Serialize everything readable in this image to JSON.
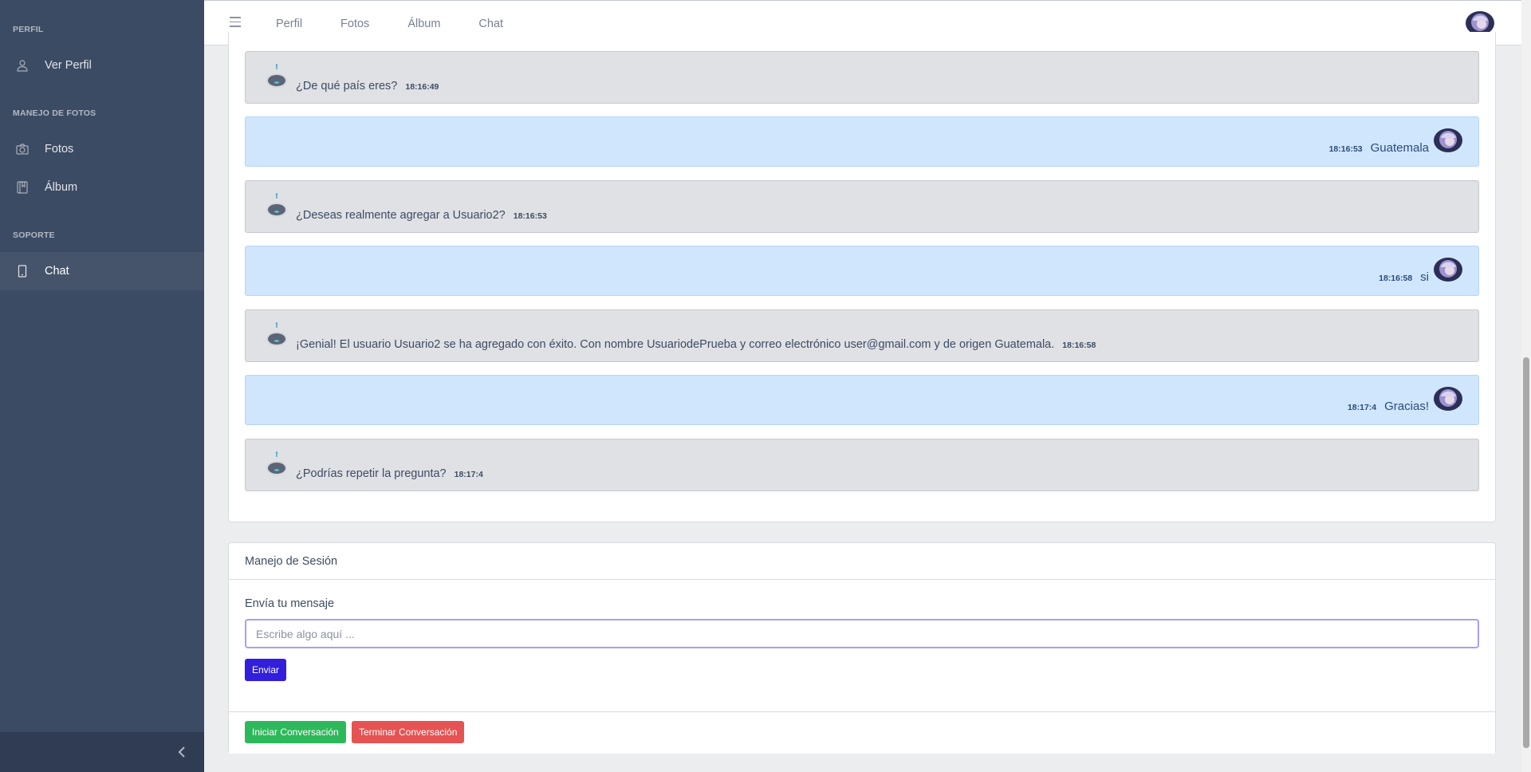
{
  "sidebar": {
    "sections": [
      {
        "title": "PERFIL",
        "items": [
          {
            "label": "Ver Perfil",
            "icon": "user-icon"
          }
        ]
      },
      {
        "title": "MANEJO DE FOTOS",
        "items": [
          {
            "label": "Fotos",
            "icon": "camera-icon"
          },
          {
            "label": "Álbum",
            "icon": "book-icon"
          }
        ]
      },
      {
        "title": "SOPORTE",
        "items": [
          {
            "label": "Chat",
            "icon": "phone-icon",
            "active": true
          }
        ]
      }
    ],
    "toggle_icon": "chevron-left-icon"
  },
  "header": {
    "menu_icon": "hamburger-icon",
    "nav": [
      "Perfil",
      "Fotos",
      "Álbum",
      "Chat"
    ],
    "avatar_icon": "user-avatar"
  },
  "chat": {
    "messages": [
      {
        "sender": "bot",
        "text": "¿De qué país eres?",
        "time": "18:16:49"
      },
      {
        "sender": "user",
        "text": "Guatemala",
        "time": "18:16:53"
      },
      {
        "sender": "bot",
        "text": "¿Deseas realmente agregar a Usuario2?",
        "time": "18:16:53"
      },
      {
        "sender": "user",
        "text": "si",
        "time": "18:16:58"
      },
      {
        "sender": "bot",
        "text": "¡Genial! El usuario Usuario2 se ha agregado con éxito. Con nombre UsuariodePrueba y correo electrónico user@gmail.com y de origen Guatemala.",
        "time": "18:16:58"
      },
      {
        "sender": "user",
        "text": "Gracias!",
        "time": "18:17:4"
      },
      {
        "sender": "bot",
        "text": "¿Podrías repetir la pregunta?",
        "time": "18:17:4"
      }
    ]
  },
  "session": {
    "title": "Manejo de Sesión",
    "input_label": "Envía tu mensaje",
    "input_placeholder": "Escribe algo aquí ...",
    "input_value": "",
    "send_label": "Enviar",
    "start_label": "Iniciar Conversación",
    "end_label": "Terminar Conversación"
  },
  "colors": {
    "sidebar_bg": "#3c4b64",
    "bot_msg_bg": "#e0e1e4",
    "user_msg_bg": "#d0e6fc",
    "primary": "#321fdb",
    "success": "#2eb85c",
    "danger": "#e55353"
  }
}
